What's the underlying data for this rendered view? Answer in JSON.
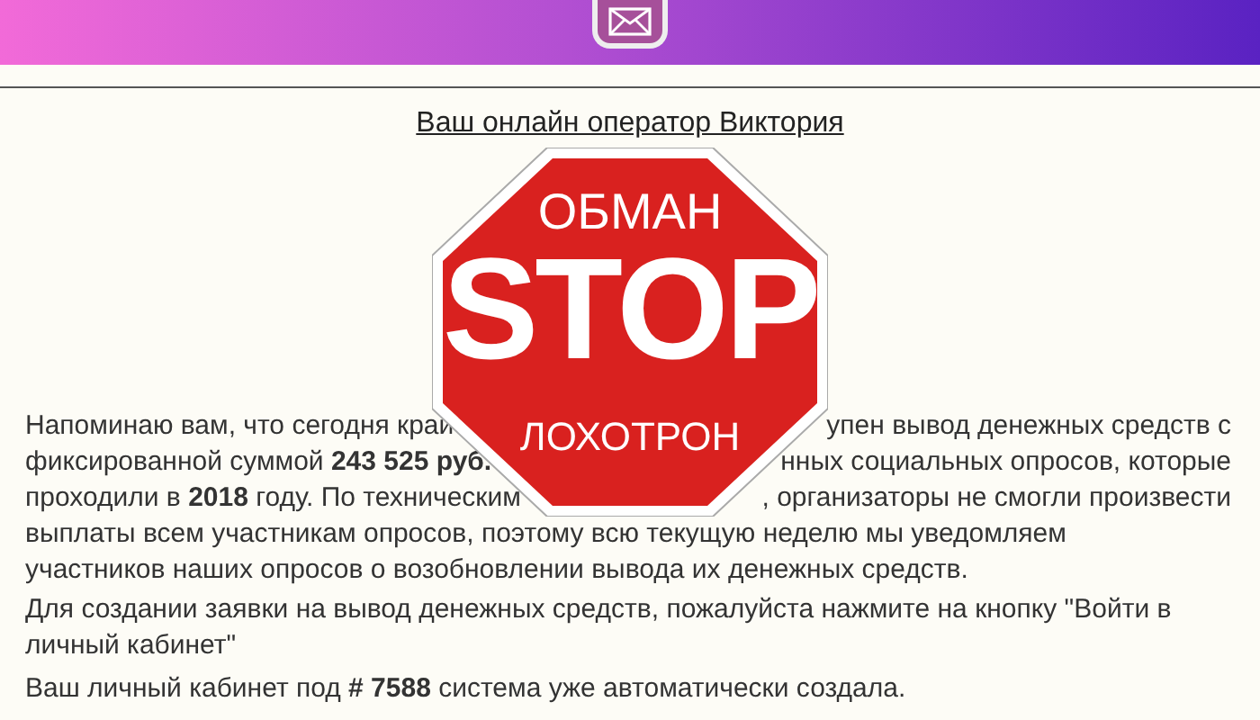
{
  "operator_link": "Ваш онлайн оператор Виктория",
  "stop_sign": {
    "top": "ОБМАН",
    "main": "STOP",
    "bottom": "ЛОХОТРОН"
  },
  "first_paragraph_lines": [
    {
      "kind": "split",
      "left": "Напоминаю вам, что сегодня край",
      "right": "упен вывод денежных средств с"
    },
    {
      "kind": "split",
      "left": "фиксированной суммой **243 525 руб.**",
      "right": "нных социальных опросов, которые"
    },
    {
      "kind": "split",
      "left": "проходили в **2018** году. По техническим",
      "right": ", организаторы не смогли произвести"
    },
    {
      "kind": "full",
      "text": "выплаты всем участникам опросов, поэтому всю текущую неделю мы уведомляем"
    },
    {
      "kind": "full",
      "text": "участников наших опросов о возобновлении вывода их денежных средств."
    }
  ],
  "paragraphs": [
    "Для создании заявки на вывод денежных средств, пожалуйста нажмите на кнопку \"Войти в личный кабинет\"",
    "Ваш личный кабинет под **# 7588** система уже автоматически создала."
  ]
}
